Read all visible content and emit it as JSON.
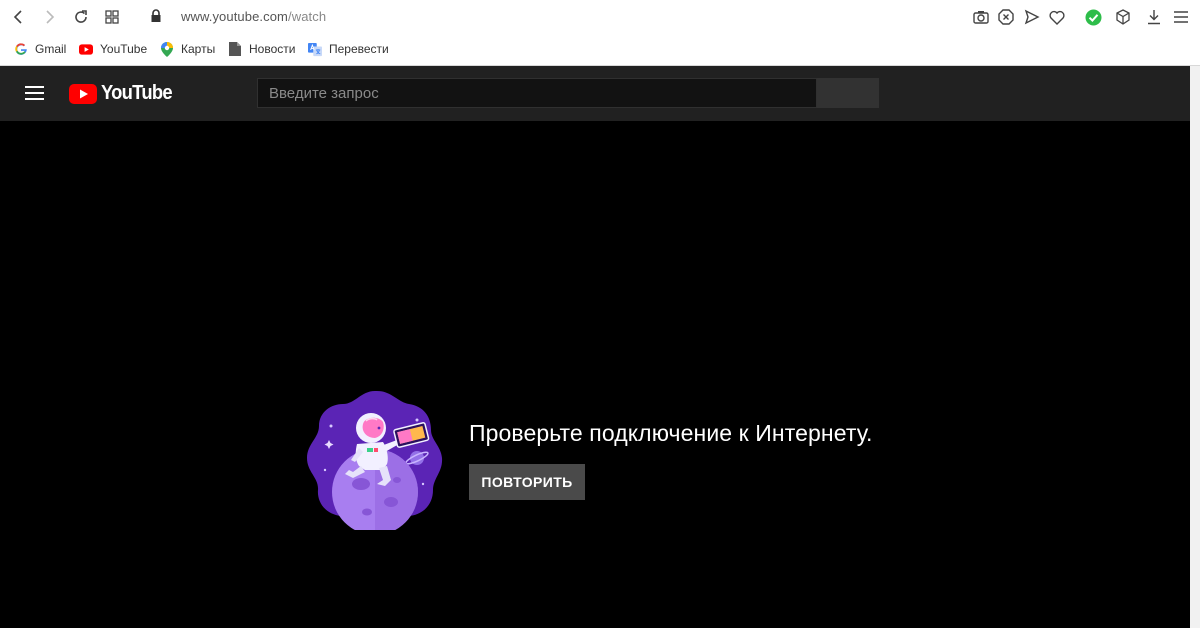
{
  "browser": {
    "url_host": "www.youtube.com",
    "url_path": "/watch",
    "bookmarks": [
      {
        "label": "Gmail",
        "icon": "google-icon"
      },
      {
        "label": "YouTube",
        "icon": "youtube-icon"
      },
      {
        "label": "Карты",
        "icon": "maps-pin-icon"
      },
      {
        "label": "Новости",
        "icon": "document-icon"
      },
      {
        "label": "Перевести",
        "icon": "translate-icon"
      }
    ]
  },
  "youtube": {
    "logo_text": "YouTube",
    "search_placeholder": "Введите запрос",
    "accent_color": "#ff0000"
  },
  "error": {
    "message": "Проверьте подключение к Интернету.",
    "retry_label": "ПОВТОРИТЬ"
  }
}
